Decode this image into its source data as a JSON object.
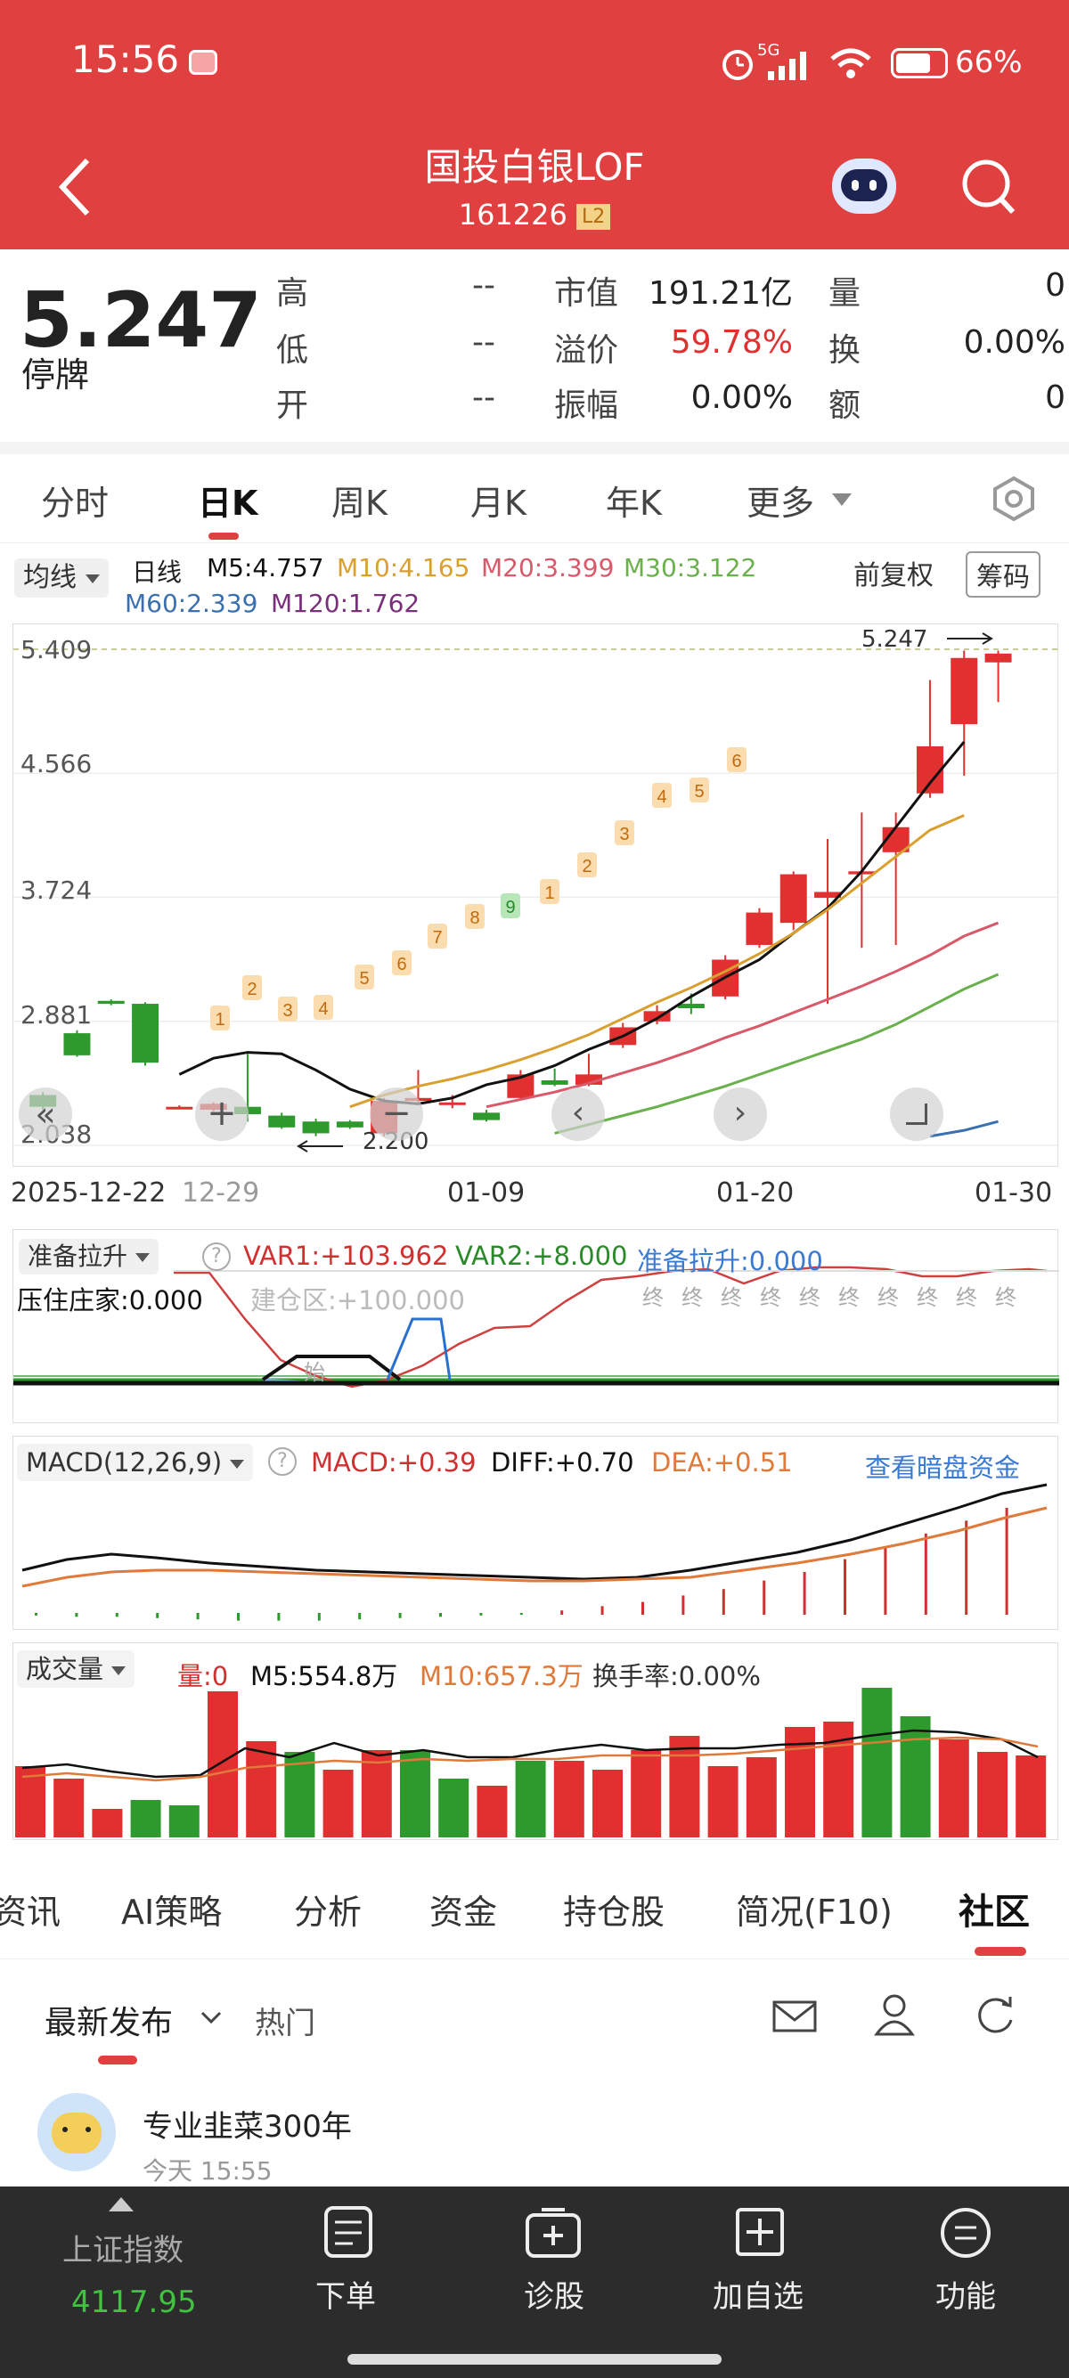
{
  "status_bar": {
    "time": "15:56",
    "network": "5G",
    "battery": "66%"
  },
  "header": {
    "title": "国投白银LOF",
    "code": "161226",
    "level_badge": "L2"
  },
  "quote": {
    "price": "5.247",
    "status": "停牌",
    "high_label": "高",
    "high_value": "--",
    "low_label": "低",
    "low_value": "--",
    "open_label": "开",
    "open_value": "--",
    "mktcap_label": "市值",
    "mktcap_value": "191.21亿",
    "premium_label": "溢价",
    "premium_value": "59.78%",
    "amplitude_label": "振幅",
    "amplitude_value": "0.00%",
    "volume_label": "量",
    "volume_value": "0",
    "turnover_label": "换",
    "turnover_value": "0.00%",
    "amount_label": "额",
    "amount_value": "0"
  },
  "period_tabs": [
    "分时",
    "日K",
    "周K",
    "月K",
    "年K",
    "更多"
  ],
  "active_period": "日K",
  "ma_legend": {
    "selector": "均线",
    "period": "日线",
    "m5": "M5:4.757",
    "m10": "M10:4.165",
    "m20": "M20:3.399",
    "m30": "M30:3.122",
    "m60": "M60:2.339",
    "m120": "M120:1.762",
    "adjust": "前复权",
    "chips_button": "筹码"
  },
  "kline": {
    "price_labels": [
      "5.409",
      "4.566",
      "3.724",
      "2.881",
      "2.038"
    ],
    "last_marker": "5.247",
    "low_marker": "2.200",
    "dates": [
      "2025-12-22",
      "12-29",
      "01-09",
      "01-20",
      "01-30"
    ]
  },
  "indicator1": {
    "selector": "准备拉升",
    "var1": "VAR1:+103.962",
    "var2": "VAR2:+8.000",
    "ready": "准备拉升:0.000",
    "dealer": "压住庄家:0.000",
    "build": "建仓区:+100.000",
    "end_mark": "终",
    "start_mark": "始"
  },
  "macd": {
    "selector": "MACD(12,26,9)",
    "macd": "MACD:+0.39",
    "diff": "DIFF:+0.70",
    "dea": "DEA:+0.51",
    "link": "查看暗盘资金"
  },
  "volume": {
    "selector": "成交量",
    "vol": "量:0",
    "m5": "M5:554.8万",
    "m10": "M10:657.3万",
    "turn": "换手率:0.00%"
  },
  "bottom_tabs": [
    "资讯",
    "AI策略",
    "分析",
    "资金",
    "持仓股",
    "简况(F10)",
    "社区"
  ],
  "community": {
    "sort_latest": "最新发布",
    "sort_hot": "热门",
    "post_user": "专业韭菜300年",
    "post_time": "今天  15:55"
  },
  "dock": {
    "index_name": "上证指数",
    "index_value": "4117.95",
    "items": [
      "下单",
      "诊股",
      "加自选",
      "功能"
    ]
  },
  "colors": {
    "brand_red": "#e04040",
    "up_red": "#e03030",
    "down_green": "#2e9a2e",
    "ma5": "#111111",
    "ma10": "#d9a030",
    "ma20": "#d85a6a",
    "ma30": "#6ab04c",
    "ma60": "#3a70b0",
    "ma120": "#7a2f7a"
  },
  "chart_data": {
    "type": "candlestick",
    "ylim": [
      2.038,
      5.409
    ],
    "y_ticks": [
      5.409,
      4.566,
      3.724,
      2.881,
      2.038
    ],
    "x_ticks": [
      "2025-12-22",
      "12-29",
      "01-09",
      "01-20",
      "01-30"
    ],
    "candles": [
      {
        "o": 2.38,
        "c": 2.3,
        "h": 2.4,
        "l": 2.28
      },
      {
        "o": 2.8,
        "c": 2.65,
        "h": 2.82,
        "l": 2.64
      },
      {
        "o": 3.02,
        "c": 3.0,
        "h": 3.03,
        "l": 2.99
      },
      {
        "o": 3.0,
        "c": 2.6,
        "h": 3.01,
        "l": 2.58
      },
      {
        "o": 2.3,
        "c": 2.3,
        "h": 2.31,
        "l": 2.29
      },
      {
        "o": 2.28,
        "c": 2.32,
        "h": 2.33,
        "l": 2.27
      },
      {
        "o": 2.3,
        "c": 2.25,
        "h": 2.66,
        "l": 2.2
      },
      {
        "o": 2.24,
        "c": 2.16,
        "h": 2.26,
        "l": 2.15
      },
      {
        "o": 2.2,
        "c": 2.12,
        "h": 2.22,
        "l": 2.1
      },
      {
        "o": 2.2,
        "c": 2.16,
        "h": 2.21,
        "l": 2.15
      },
      {
        "o": 2.12,
        "c": 2.34,
        "h": 2.36,
        "l": 2.1
      },
      {
        "o": 2.34,
        "c": 2.36,
        "h": 2.55,
        "l": 2.32
      },
      {
        "o": 2.33,
        "c": 2.33,
        "h": 2.38,
        "l": 2.29
      },
      {
        "o": 2.26,
        "c": 2.21,
        "h": 2.28,
        "l": 2.2
      },
      {
        "o": 2.36,
        "c": 2.52,
        "h": 2.55,
        "l": 2.35
      },
      {
        "o": 2.48,
        "c": 2.45,
        "h": 2.56,
        "l": 2.44
      },
      {
        "o": 2.45,
        "c": 2.52,
        "h": 2.66,
        "l": 2.44
      },
      {
        "o": 2.72,
        "c": 2.84,
        "h": 2.87,
        "l": 2.7
      },
      {
        "o": 2.88,
        "c": 2.95,
        "h": 2.99,
        "l": 2.86
      },
      {
        "o": 3.0,
        "c": 2.97,
        "h": 3.07,
        "l": 2.93
      },
      {
        "o": 3.05,
        "c": 3.3,
        "h": 3.33,
        "l": 3.03
      },
      {
        "o": 3.4,
        "c": 3.62,
        "h": 3.65,
        "l": 3.38
      },
      {
        "o": 3.55,
        "c": 3.88,
        "h": 3.9,
        "l": 3.5
      },
      {
        "o": 3.72,
        "c": 3.76,
        "h": 4.12,
        "l": 3.0
      },
      {
        "o": 3.88,
        "c": 3.9,
        "h": 4.3,
        "l": 3.38
      },
      {
        "o": 4.03,
        "c": 4.2,
        "h": 4.3,
        "l": 3.4
      },
      {
        "o": 4.43,
        "c": 4.75,
        "h": 5.2,
        "l": 4.4
      },
      {
        "o": 4.9,
        "c": 5.35,
        "h": 5.4,
        "l": 4.55
      },
      {
        "o": 5.32,
        "c": 5.38,
        "h": 5.4,
        "l": 5.05
      }
    ],
    "ma5": [
      2.52,
      2.63,
      2.67,
      2.66,
      2.55,
      2.42,
      2.34,
      2.32,
      2.36,
      2.45,
      2.5,
      2.58,
      2.69,
      2.78,
      2.9,
      3.05,
      3.18,
      3.3,
      3.48,
      3.65,
      3.9,
      4.2,
      4.5,
      4.78
    ],
    "ma10": [
      2.3,
      2.38,
      2.44,
      2.49,
      2.55,
      2.62,
      2.7,
      2.79,
      2.9,
      3.01,
      3.11,
      3.22,
      3.34,
      3.48,
      3.64,
      3.82,
      4.0,
      4.18,
      4.28
    ],
    "ma20": [
      2.3,
      2.35,
      2.4,
      2.46,
      2.53,
      2.6,
      2.68,
      2.77,
      2.85,
      2.94,
      3.03,
      3.12,
      3.22,
      3.33,
      3.46,
      3.55
    ],
    "ma30": [
      2.12,
      2.18,
      2.24,
      2.3,
      2.37,
      2.44,
      2.52,
      2.6,
      2.68,
      2.76,
      2.86,
      2.98,
      3.1,
      3.2
    ],
    "ma60": [
      2.1,
      2.14,
      2.2
    ]
  }
}
